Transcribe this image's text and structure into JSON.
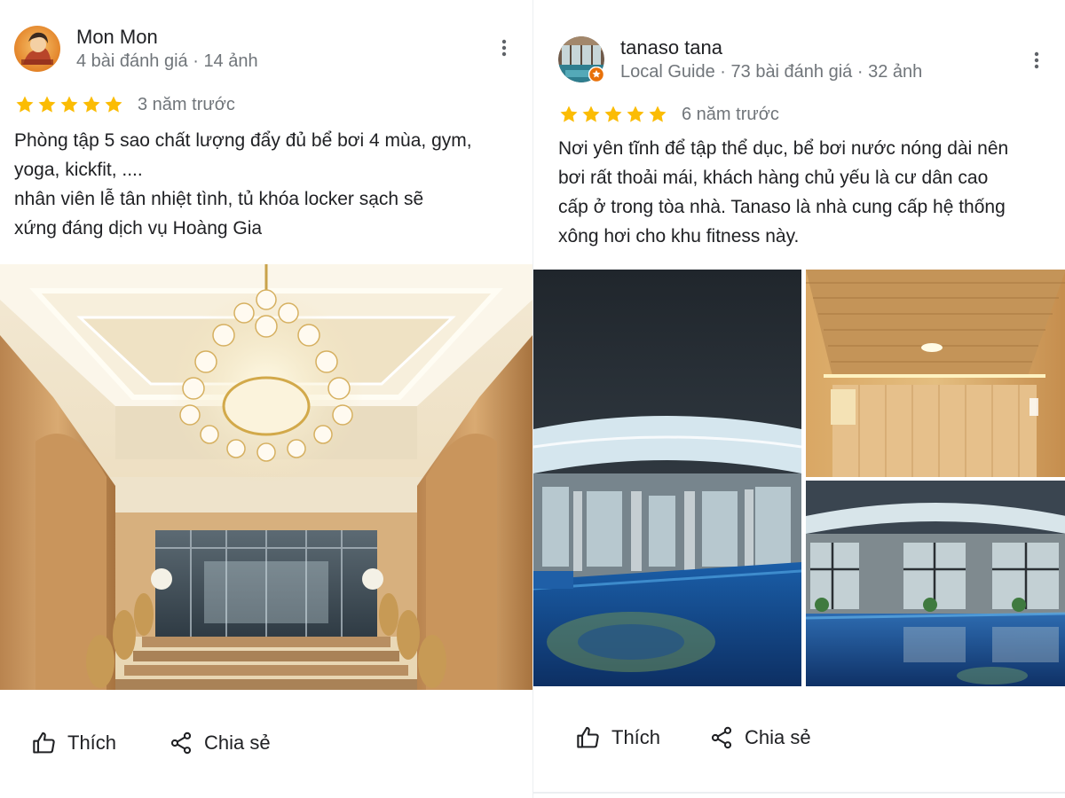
{
  "reviews": [
    {
      "author": {
        "name": "Mon Mon",
        "meta": "4 bài đánh giá · 14 ảnh"
      },
      "rating": {
        "stars": 5,
        "time": "3 năm trước"
      },
      "text": "Phòng tập 5 sao chất lượng đẩy đủ bể bơi 4 mùa, gym,\nyoga, kickfit, ....\nnhân viên lễ tân nhiệt tình, tủ khóa locker sạch sẽ\nxứng đáng dịch vụ Hoàng Gia",
      "actions": {
        "like": "Thích",
        "share": "Chia sẻ"
      }
    },
    {
      "author": {
        "name": "tanaso tana",
        "meta": "Local Guide · 73 bài đánh giá · 32 ảnh"
      },
      "rating": {
        "stars": 5,
        "time": "6 năm trước"
      },
      "text": "Nơi yên tĩnh để tập thể dục, bể bơi nước nóng dài nên\nbơi rất thoải mái, khách hàng chủ yếu là cư dân cao\ncấp ở trong tòa nhà. Tanaso là nhà cung cấp hệ thống\nxông hơi cho khu fitness này.",
      "actions": {
        "like": "Thích",
        "share": "Chia sẻ"
      }
    }
  ],
  "icons": {
    "star": "star-icon",
    "more": "more-vert-icon",
    "like": "thumb-up-icon",
    "share": "share-icon",
    "local_guide": "local-guide-badge-icon"
  },
  "colors": {
    "star": "#fbbc04",
    "meta_text": "#70757a",
    "text": "#202124",
    "local_guide_badge": "#e8710a"
  }
}
